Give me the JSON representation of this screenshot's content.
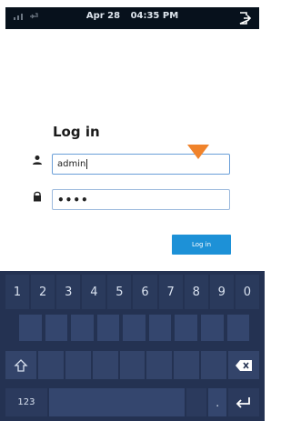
{
  "status_bar": {
    "date": "Apr 28",
    "time": "04:35 PM",
    "left_icons": [
      "network-icon",
      "usb-icon"
    ],
    "right_icon": "logout-icon"
  },
  "login": {
    "title": "Log in",
    "username_value": "admin",
    "password_value": "••••",
    "login_button_label": "Log in"
  },
  "keyboard": {
    "number_row": [
      "1",
      "2",
      "3",
      "4",
      "5",
      "6",
      "7",
      "8",
      "9",
      "0"
    ],
    "mode_key_label": "123",
    "dot_key_label": ".",
    "icons": [
      "shift-icon",
      "backspace-icon",
      "enter-icon"
    ]
  },
  "colors": {
    "status_bar_bg": "#07111c",
    "keyboard_bg": "#243252",
    "accent_button": "#1d91d7",
    "input_border": "#6a9fd8",
    "marker": "#f0832b"
  }
}
